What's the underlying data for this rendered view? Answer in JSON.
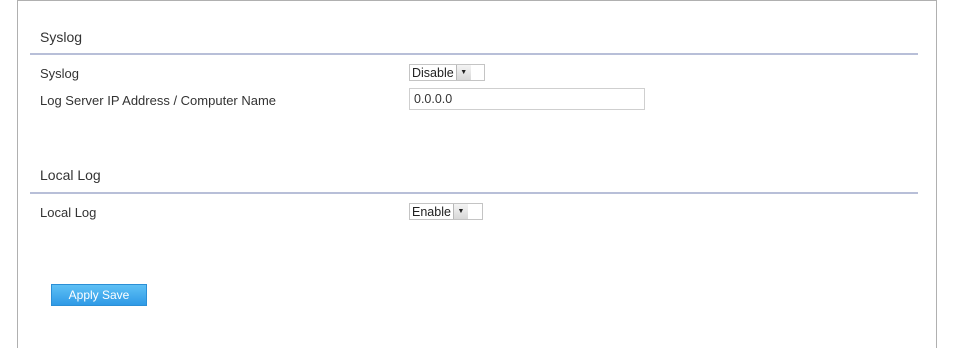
{
  "syslog_section": {
    "title": "Syslog",
    "syslog_label": "Syslog",
    "syslog_value": "Disable",
    "server_label": "Log Server IP Address / Computer Name",
    "server_value": "0.0.0.0"
  },
  "local_log_section": {
    "title": "Local Log",
    "local_log_label": "Local Log",
    "local_log_value": "Enable"
  },
  "actions": {
    "apply_label": "Apply Save"
  },
  "colors": {
    "accent": "#2f9ae6",
    "divider": "#b8bfd8"
  }
}
